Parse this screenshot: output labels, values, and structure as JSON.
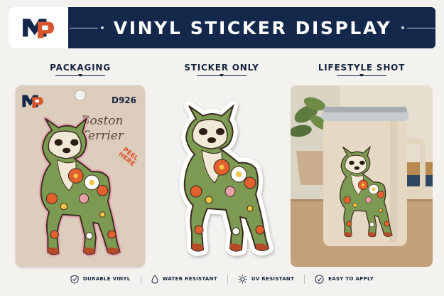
{
  "header": {
    "title": "VINYL STICKER DISPLAY",
    "logo_icon": "mp-logo-icon",
    "colors": {
      "navy": "#13284a",
      "accent": "#d8552d"
    }
  },
  "sections": [
    {
      "label": "PACKAGING"
    },
    {
      "label": "STICKER ONLY"
    },
    {
      "label": "LIFESTYLE SHOT"
    }
  ],
  "packaging": {
    "code": "D926",
    "name_line1": "Boston",
    "name_line2": "Terrier",
    "peel_line1": "PEEL",
    "peel_line2": "HERE"
  },
  "features": [
    {
      "icon": "shield-check-icon",
      "label": "DURABLE VINYL"
    },
    {
      "icon": "water-drop-icon",
      "label": "WATER RESISTANT"
    },
    {
      "icon": "sun-icon",
      "label": "UV RESISTANT"
    },
    {
      "icon": "check-circle-icon",
      "label": "EASY TO APPLY"
    }
  ]
}
